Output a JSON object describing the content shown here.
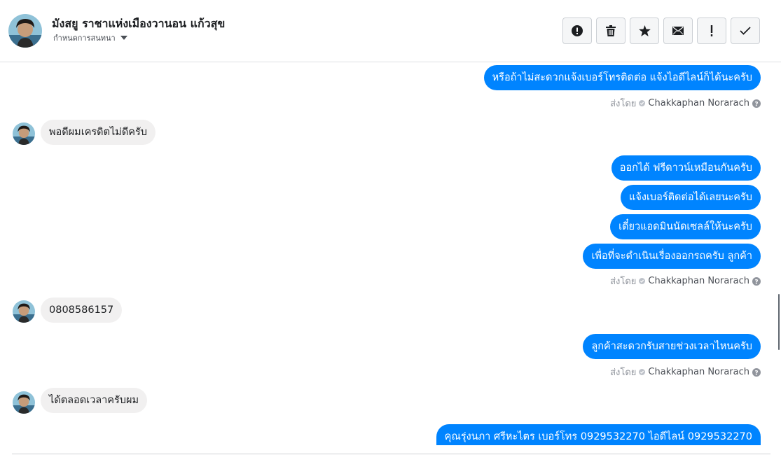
{
  "header": {
    "contact_name": "มังสยู ราชาแห่งเมืองวานอน แก้วสุข",
    "conversation_settings_label": "กำหนดการสนทนา",
    "toolbar_icons": [
      "spam-icon",
      "trash-icon",
      "star-icon",
      "envelope-icon",
      "important-icon",
      "check-icon"
    ]
  },
  "sent_by_label": "ส่งโดย",
  "agent_name": "Chakkaphan Norarach",
  "messages": [
    {
      "dir": "out",
      "text": "หรือถ้าไม่สะดวกแจ้งเบอร์โทรติดต่อ แจ้งไอดีไลน์ก็ได้นะครับ"
    },
    {
      "dir": "in",
      "text": "พอดีผมเครดิตไม่ดีครับ"
    },
    {
      "dir": "out",
      "text": "ออกได้ ฟรีดาวน์เหมือนกันครับ"
    },
    {
      "dir": "out",
      "text": "แจ้งเบอร์ติดต่อได้เลยนะครับ"
    },
    {
      "dir": "out",
      "text": "เดี๋ยวแอดมินนัดเซลล์ให้นะครับ"
    },
    {
      "dir": "out",
      "text": "เพื่อที่จะดำเนินเรื่องออกรถครับ ลูกค้า"
    },
    {
      "dir": "in",
      "text": "0808586157"
    },
    {
      "dir": "out",
      "text": "ลูกค้าสะดวกรับสายช่วงเวลาไหนครับ"
    },
    {
      "dir": "in",
      "text": "ได้ตลอดเวลาครับผม"
    },
    {
      "dir": "out",
      "text": "คุณรุ่งนภา ศรีหะไตร        เบอร์โทร 0929532270  ไอดีไลน์ 0929532270"
    }
  ],
  "colors": {
    "outgoing_bubble": "#0084ff",
    "incoming_bubble": "#f1f0f0",
    "muted_text": "#90949c"
  }
}
